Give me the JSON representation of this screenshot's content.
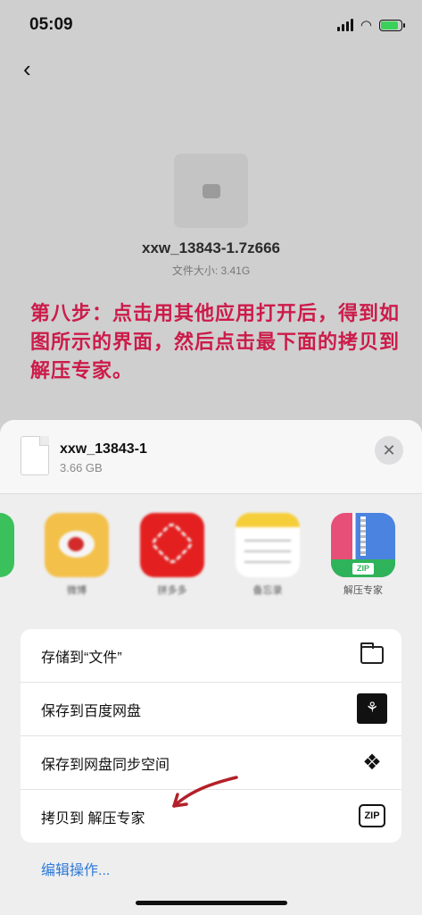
{
  "status": {
    "time": "05:09"
  },
  "file": {
    "name": "xxw_13843-1.7z666",
    "size": "文件大小: 3.41G"
  },
  "note": "第八步：点击用其他应用打开后，得到如图所示的界面，然后点击最下面的拷贝到解压专家。",
  "sheet": {
    "title": "xxw_13843-1",
    "subtitle": "3.66 GB",
    "apps": [
      {
        "label": "微博",
        "icon": "weibo-icon"
      },
      {
        "label": "拼多多",
        "icon": "pinduoduo-icon"
      },
      {
        "label": "备忘录",
        "icon": "notes-icon"
      },
      {
        "label": "解压专家",
        "icon": "unzip-expert-icon"
      }
    ],
    "actions": [
      {
        "label": "存储到“文件”",
        "icon": "folder-icon"
      },
      {
        "label": "保存到百度网盘",
        "icon": "baidu-netdisk-icon"
      },
      {
        "label": "保存到网盘同步空间",
        "icon": "sync-space-icon"
      },
      {
        "label": "拷贝到 解压专家",
        "icon": "zip-icon"
      }
    ],
    "edit_label": "编辑操作..."
  },
  "colors": {
    "note": "#cc1b4a",
    "link": "#2d7ad8",
    "accent_red": "#e41f1f",
    "arrow": "#b3202a"
  }
}
